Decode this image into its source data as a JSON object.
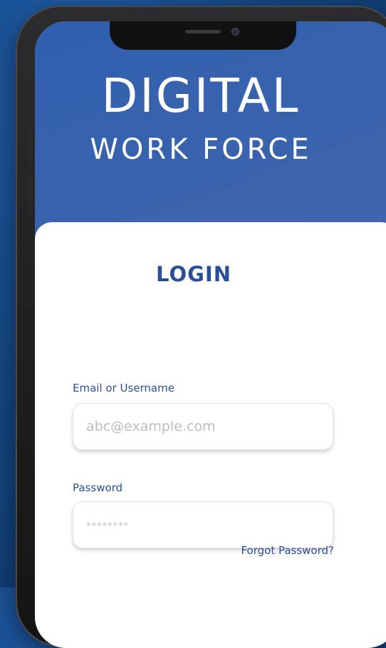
{
  "brand": {
    "title_line1": "DIGITAL",
    "title_line2": "WORK FORCE"
  },
  "login": {
    "title": "LOGIN",
    "email_label": "Email or Username",
    "email_placeholder": "abc@example.com",
    "password_label": "Password",
    "password_placeholder": "********",
    "forgot_password": "Forgot Password?"
  },
  "colors": {
    "background": "#14467f",
    "header": "#3a63ad",
    "accent_text": "#2a4f9a",
    "card": "#ffffff"
  }
}
